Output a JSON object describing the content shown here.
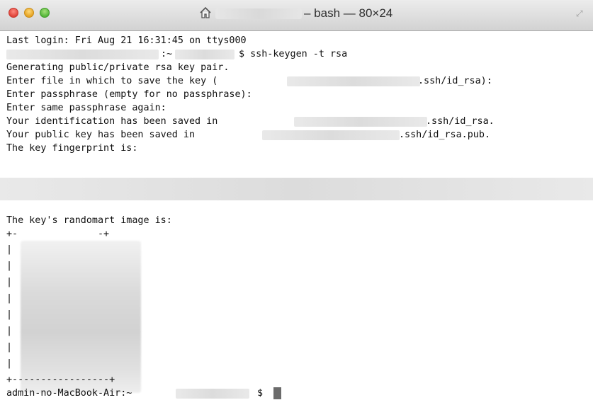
{
  "window": {
    "title": "– bash — 80×24",
    "home_icon": "house-icon",
    "resize_icon": "fullscreen-icon",
    "traffic_lights": [
      "close",
      "minimize",
      "zoom"
    ],
    "colors": {
      "close": "#e0443a",
      "minimize": "#e5a323",
      "zoom": "#55b63a",
      "terminal_background": "#ffffff",
      "terminal_text": "#111111"
    }
  },
  "terminal": {
    "last_login": "Last login: Fri Aug 21 16:31:45 on ttys000",
    "prompt_path": ":~",
    "command": "$ ssh-keygen -t rsa",
    "generating": "Generating public/private rsa key pair.",
    "enter_file": "Enter file in which to save the key (",
    "enter_file_suffix": ".ssh/id_rsa):",
    "enter_passphrase": "Enter passphrase (empty for no passphrase):",
    "enter_same": "Enter same passphrase again:",
    "identification_saved": "Your identification has been saved in",
    "identification_suffix": ".ssh/id_rsa.",
    "public_key_saved": "Your public key has been saved in",
    "public_key_suffix": ".ssh/id_rsa.pub.",
    "fingerprint": "The key fingerprint is:",
    "randomart_heading": "The key's randomart image is:",
    "art_top": "+-              -+",
    "art_side": "|                |",
    "art_bottom": "+-----------------+",
    "final_prompt": "admin-no-MacBook-Air:~",
    "final_prompt_symbol": "$"
  }
}
